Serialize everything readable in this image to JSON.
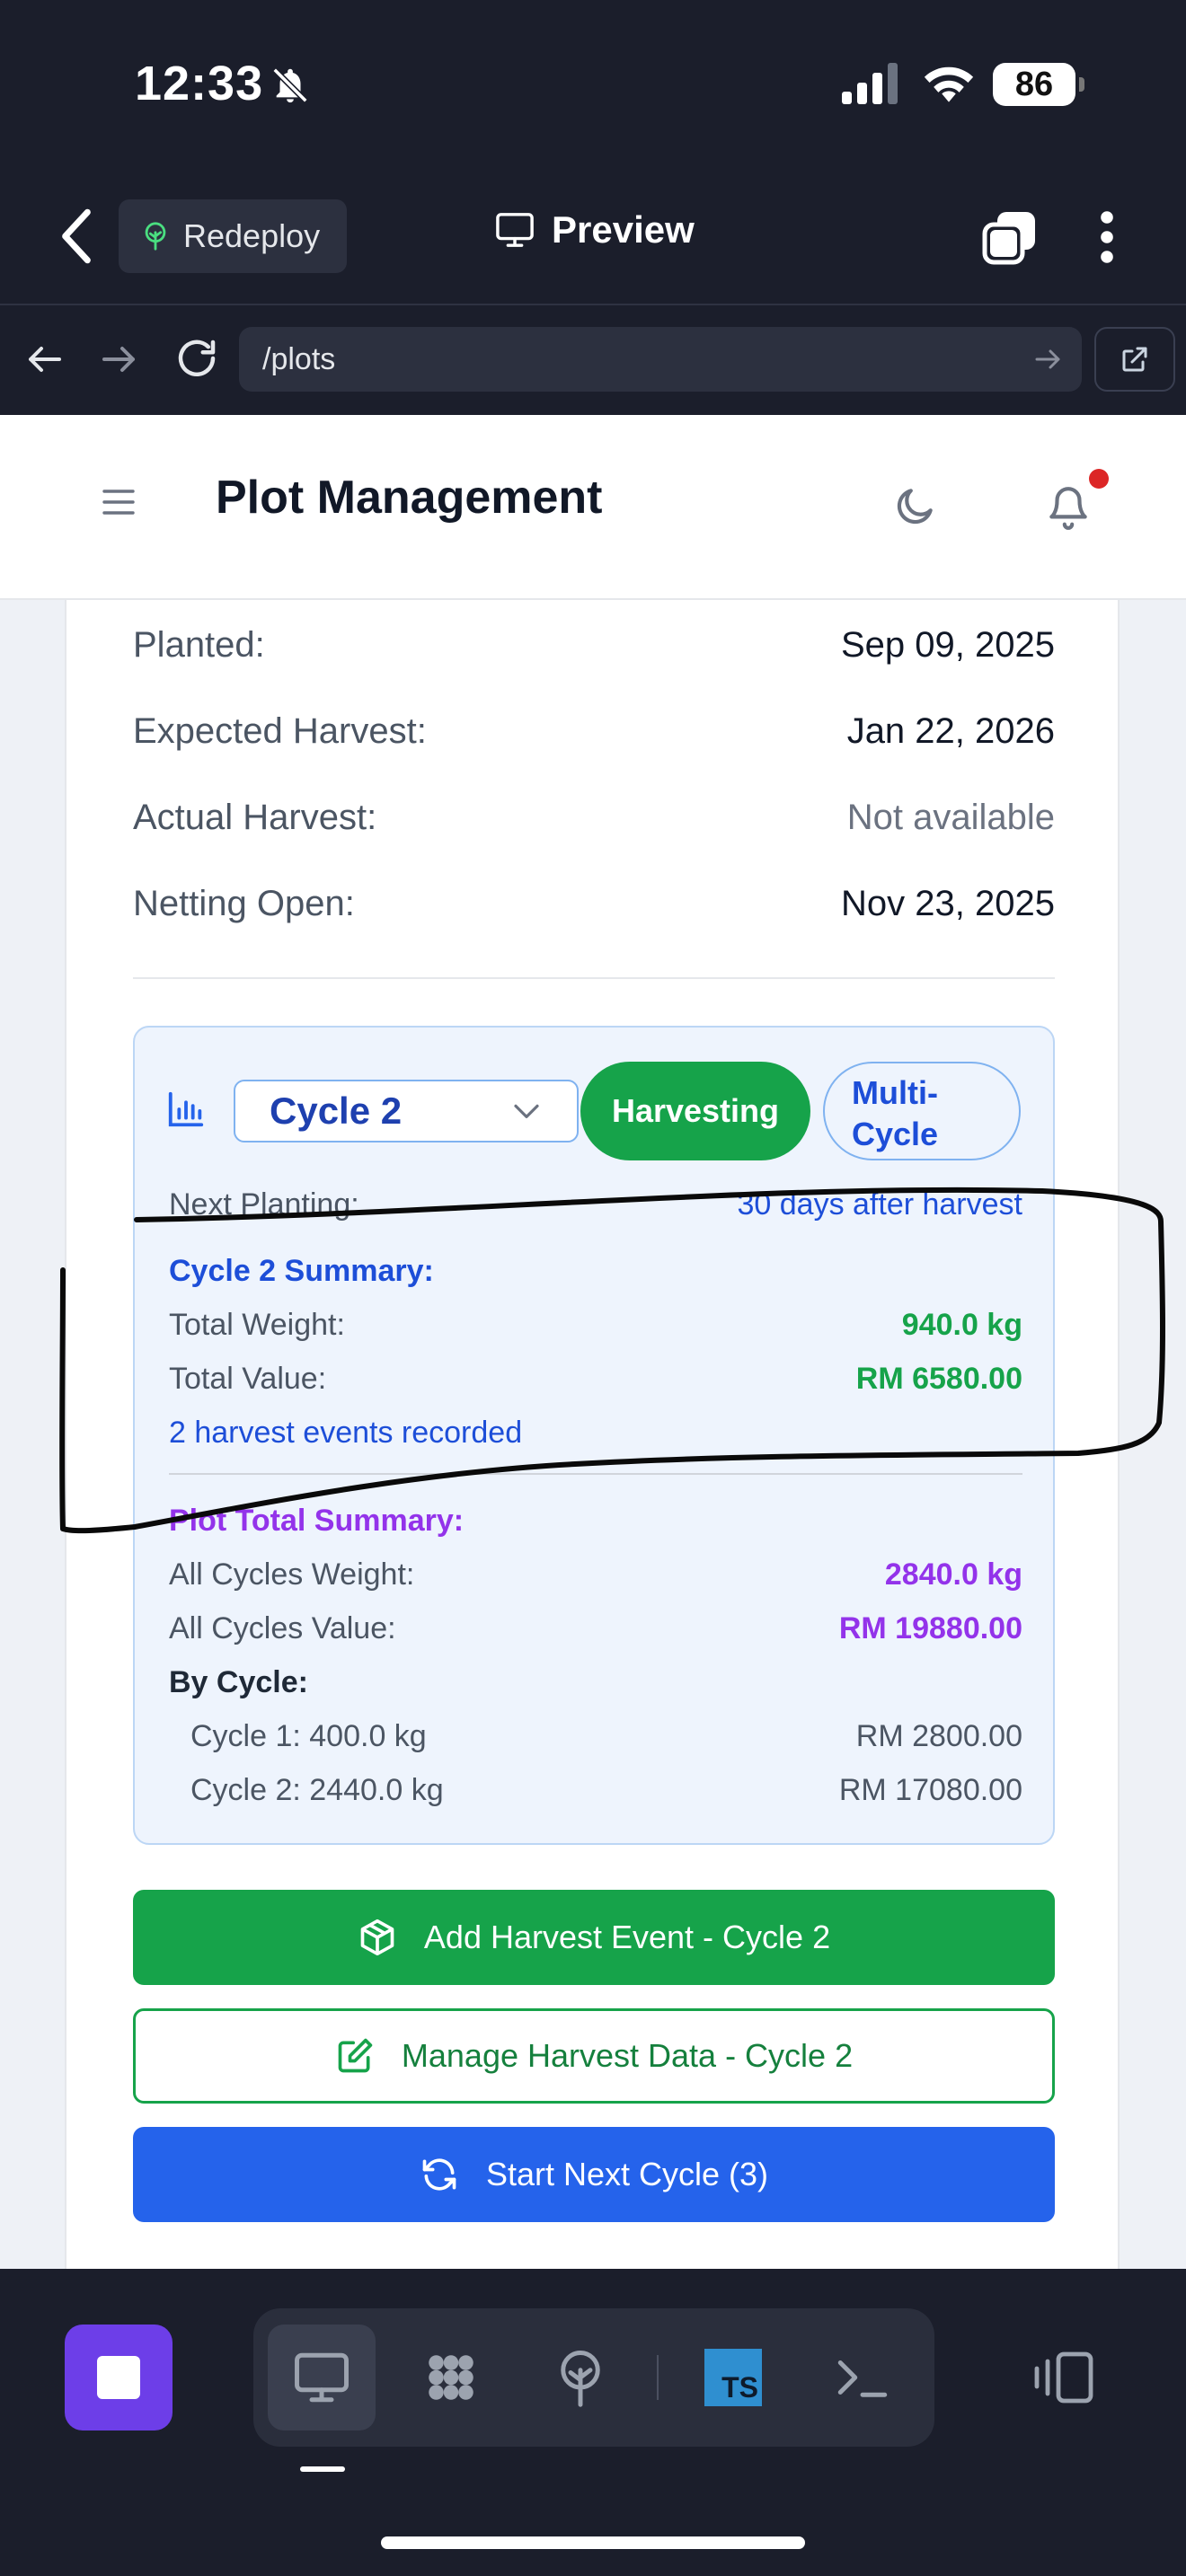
{
  "status_bar": {
    "time": "12:33",
    "battery": "86"
  },
  "browser": {
    "redeploy_label": "Redeploy",
    "preview_label": "Preview",
    "url": "/plots"
  },
  "header": {
    "title": "Plot Management"
  },
  "plot_info": {
    "rows": [
      {
        "label": "Planted:",
        "value": "Sep 09, 2025"
      },
      {
        "label": "Expected Harvest:",
        "value": "Jan 22, 2026"
      },
      {
        "label": "Actual Harvest:",
        "value": "Not available"
      },
      {
        "label": "Netting Open:",
        "value": "Nov 23, 2025"
      }
    ]
  },
  "cycle": {
    "selected": "Cycle 2",
    "status": "Harvesting",
    "multi_cycle": [
      "Multi-",
      "Cycle"
    ],
    "next_planting_label": "Next Planting:",
    "next_planting_value": "30 days after harvest",
    "summary_title": "Cycle 2 Summary:",
    "total_weight_label": "Total Weight:",
    "total_weight_value": "940.0 kg",
    "total_value_label": "Total Value:",
    "total_value_value": "RM 6580.00",
    "events_recorded": "2 harvest events recorded"
  },
  "plot_total": {
    "title": "Plot Total Summary:",
    "weight_label": "All Cycles Weight:",
    "weight_value": "2840.0 kg",
    "value_label": "All Cycles Value:",
    "value_value": "RM 19880.00",
    "by_cycle_label": "By Cycle:",
    "by_cycle": [
      {
        "label": "Cycle 1: 400.0 kg",
        "value": "RM 2800.00"
      },
      {
        "label": "Cycle 2: 2440.0 kg",
        "value": "RM 17080.00"
      }
    ]
  },
  "actions": {
    "add_harvest": "Add Harvest Event - Cycle 2",
    "manage_harvest": "Manage Harvest Data - Cycle 2",
    "start_next": "Start Next Cycle (3)"
  },
  "toolbar": {
    "ts_label": "TS"
  },
  "colors": {
    "green": "#16a34a",
    "blue": "#2563eb",
    "purple": "#9333ea",
    "stop": "#6d3ee8"
  }
}
